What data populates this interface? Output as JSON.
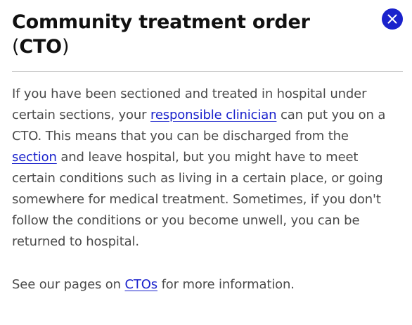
{
  "dialog": {
    "title_main": "Community treatment order",
    "title_paren_open": "(",
    "title_abbr": "CTO",
    "title_paren_close": ")",
    "close_icon": "close-icon",
    "accent_color": "#1a22cc"
  },
  "content": {
    "paragraph1": {
      "part1": "If you have been sectioned and treated in hospital under certain sections, your ",
      "link1": "responsible clinician",
      "part2": " can put you on a CTO. This means that you can be discharged from the ",
      "link2": "section",
      "part3": " and leave hospital, but you might have to meet certain conditions such as living in a certain place, or going somewhere for medical treatment. Sometimes, if you don't follow the conditions or you become unwell, you can be returned to hospital."
    },
    "paragraph2": {
      "part1": "See our pages on ",
      "link1": "CTOs",
      "part2": " for more information."
    }
  }
}
